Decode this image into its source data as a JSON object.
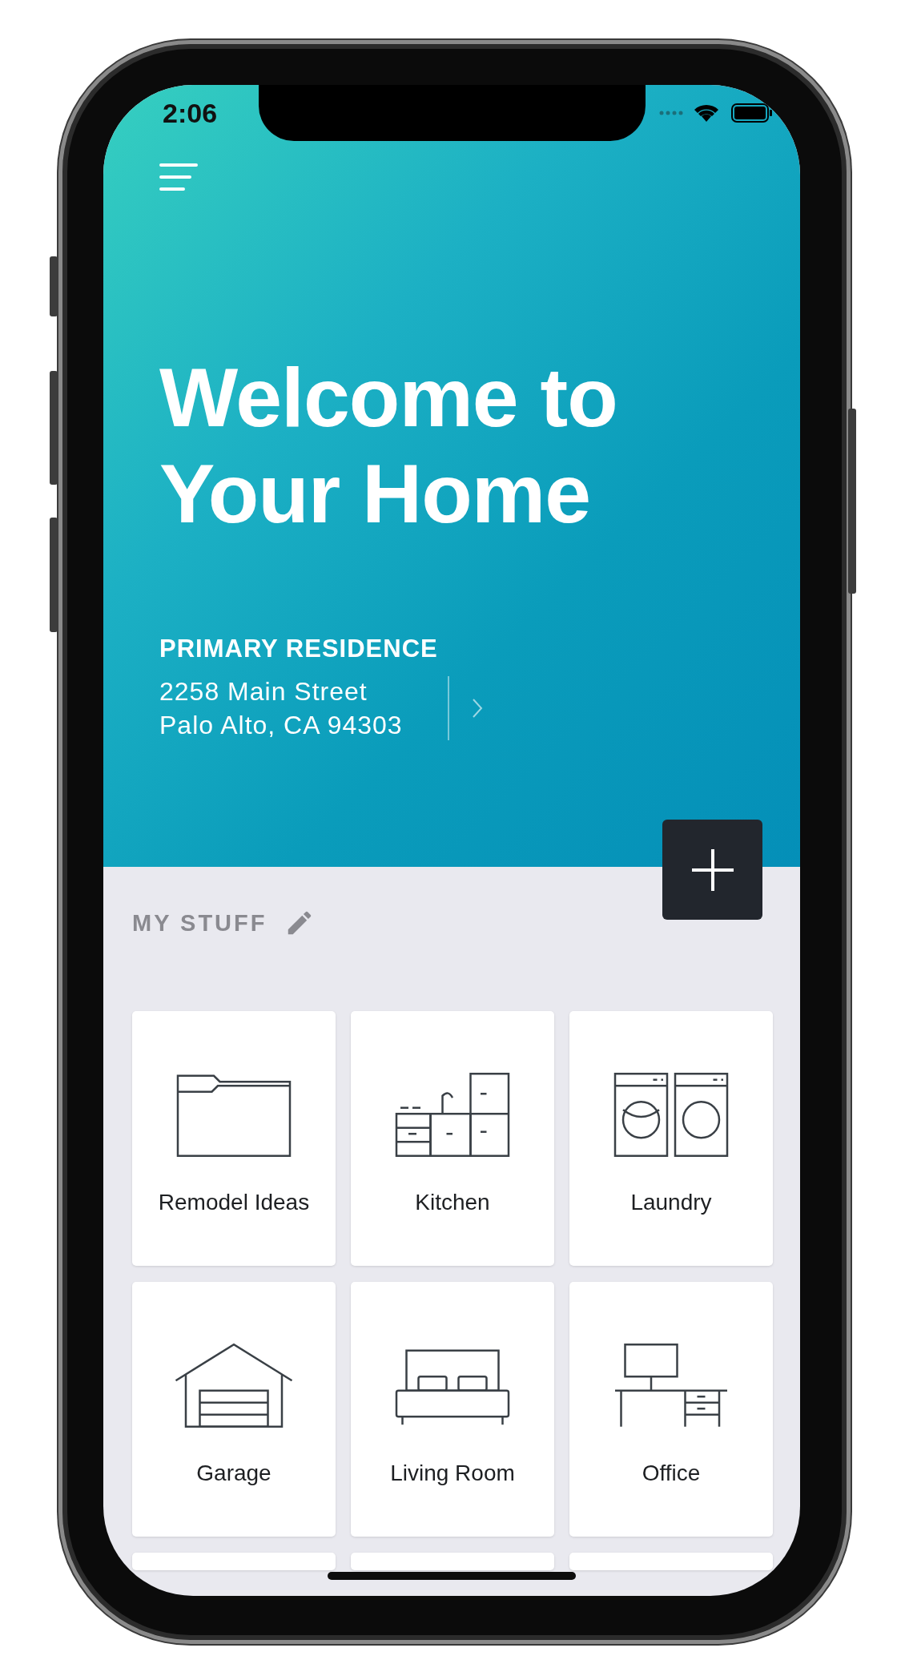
{
  "status_bar": {
    "time": "2:06"
  },
  "header": {
    "title_lines": [
      "Welcome to",
      "Your Home"
    ],
    "residence": {
      "label": "PRIMARY RESIDENCE",
      "address_lines": [
        "2258 Main Street",
        "Palo Alto, CA 94303"
      ]
    }
  },
  "section": {
    "title": "MY STUFF"
  },
  "tiles": [
    {
      "kind": "room",
      "label": "Remodel Ideas"
    },
    {
      "kind": "room",
      "label": "Kitchen"
    },
    {
      "kind": "room",
      "label": "Laundry"
    },
    {
      "kind": "room",
      "label": "Garage"
    },
    {
      "kind": "room",
      "label": "Living Room"
    },
    {
      "kind": "room",
      "label": "Office"
    },
    {
      "kind": "blank"
    },
    {
      "kind": "blank"
    },
    {
      "kind": "blank"
    }
  ]
}
